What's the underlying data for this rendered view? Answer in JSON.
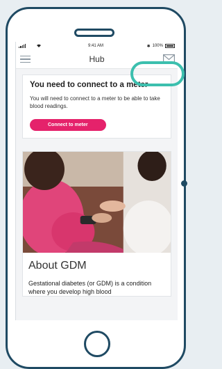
{
  "status_bar": {
    "time": "9:41 AM",
    "battery": "100%"
  },
  "nav": {
    "title": "Hub",
    "menu_icon": "hamburger-menu-icon",
    "mail_icon": "envelope-icon"
  },
  "connect_card": {
    "title": "You need to connect to a meter",
    "text": "You will need to connect to a meter to be able to take blood readings.",
    "button_label": "Connect to meter"
  },
  "article": {
    "image": "photo of pregnant woman having blood glucose tested",
    "title": "About GDM",
    "text": "Gestational diabetes (or GDM) is a condition where you develop high blood"
  },
  "colors": {
    "accent": "#e5226b",
    "highlight": "#3cbfae",
    "phone_frame": "#1f4a63"
  }
}
